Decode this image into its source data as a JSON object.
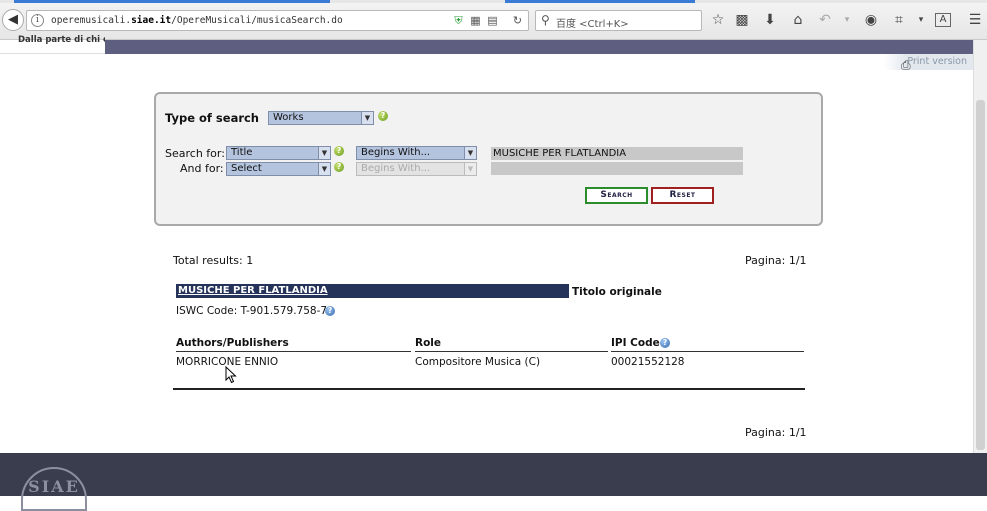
{
  "browser": {
    "url_prefix": "operemusicali.",
    "url_domain": "siae.it",
    "url_path": "/OpereMusicali/musicaSearch.do",
    "search_placeholder": "百度 <Ctrl+K>"
  },
  "header": {
    "tagline": "Dalla parte di chi crea"
  },
  "print": {
    "label": "Print version"
  },
  "search": {
    "type_label": "Type of search",
    "type_value": "Works",
    "search_for_label": "Search for:",
    "and_for_label": "And for:",
    "field1_value": "Title",
    "field2_value": "Select",
    "mode1_value": "Begins With...",
    "mode2_value": "Begins With...",
    "text1_value": "MUSICHE PER FLATLANDIA",
    "text2_value": "",
    "search_button": "Search",
    "reset_button": "Reset"
  },
  "results": {
    "total_label": "Total results: 1",
    "page_top": "Pagina: 1/1",
    "page_bottom": "Pagina: 1/1",
    "work_title": "MUSICHE PER FLATLANDIA",
    "original_title_label": "Titolo originale",
    "iswc_label": "ISWC Code: T-901.579.758-7",
    "columns": [
      "Authors/Publishers",
      "Role",
      "IPI Code"
    ],
    "rows": [
      [
        "MORRICONE ENNIO",
        "Compositore Musica (C)",
        "00021552128"
      ]
    ]
  },
  "footer": {
    "logo_text": "SIAE"
  },
  "colors": {
    "header_band": "#5e5e80",
    "title_bar": "#25335a",
    "search_border": "#2a8c2a",
    "reset_border": "#a02020",
    "footer": "#3a3d4e"
  }
}
